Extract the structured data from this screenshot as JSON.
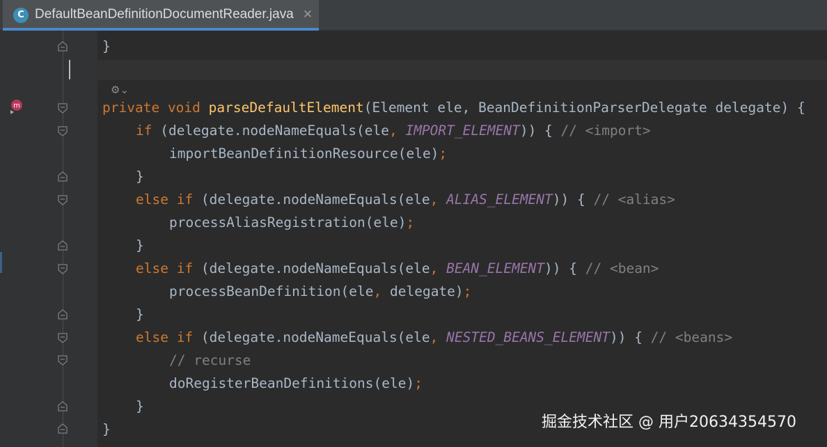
{
  "tab": {
    "file_icon_letter": "C",
    "title": "DefaultBeanDefinitionDocumentReader.java",
    "close_glyph": "✕",
    "file_icon": "java-class-icon"
  },
  "gutter": {
    "inlay_icon": "vcs-author-icon",
    "inlay_glyph": "⚙",
    "inlay_chevron": "⌄",
    "method_marker_icon": "method-implementation-icon",
    "method_marker_letter": "m"
  },
  "code": {
    "l0": {
      "t1": "}"
    },
    "l1": {
      "kw_private": "private",
      "kw_void": "void",
      "method_name": "parseDefaultElement",
      "t1": "(Element ele, BeanDefinitionParserDelegate delegate) {"
    },
    "l2": {
      "kw_if": "if",
      "t1": " (delegate.nodeNameEquals(ele",
      "comma": ",",
      "const": "IMPORT_ELEMENT",
      "t2": ")) { ",
      "comment": "// <import>"
    },
    "l3": {
      "t1": "importBeanDefinitionResource(ele)",
      "semi": ";"
    },
    "l4": {
      "t1": "}"
    },
    "l5": {
      "kw_else_if": "else if",
      "t1": " (delegate.nodeNameEquals(ele",
      "comma": ",",
      "const": "ALIAS_ELEMENT",
      "t2": ")) { ",
      "comment": "// <alias>"
    },
    "l6": {
      "t1": "processAliasRegistration(ele)",
      "semi": ";"
    },
    "l7": {
      "t1": "}"
    },
    "l8": {
      "kw_else_if": "else if",
      "t1": " (delegate.nodeNameEquals(ele",
      "comma": ",",
      "const": "BEAN_ELEMENT",
      "t2": ")) { ",
      "comment": "// <bean>"
    },
    "l9": {
      "t1": "processBeanDefinition(ele",
      "comma": ",",
      "t2": " delegate)",
      "semi": ";"
    },
    "l10": {
      "t1": "}"
    },
    "l11": {
      "kw_else_if": "else if",
      "t1": " (delegate.nodeNameEquals(ele",
      "comma": ",",
      "const": "NESTED_BEANS_ELEMENT",
      "t2": ")) { ",
      "comment": "// <beans>"
    },
    "l12": {
      "comment": "// recurse"
    },
    "l13": {
      "t1": "doRegisterBeanDefinitions(ele)",
      "semi": ";"
    },
    "l14": {
      "t1": "}"
    },
    "l15": {
      "t1": "}"
    }
  },
  "watermark": {
    "text": "掘金技术社区 @ 用户20634354570"
  },
  "colors": {
    "keyword": "#cc7832",
    "method": "#ffc66d",
    "constant": "#9876aa",
    "comment": "#808080",
    "plain": "#a9b7c6",
    "background": "#2b2b2b",
    "gutter": "#313335",
    "tab_underline": "#4a88c7"
  }
}
